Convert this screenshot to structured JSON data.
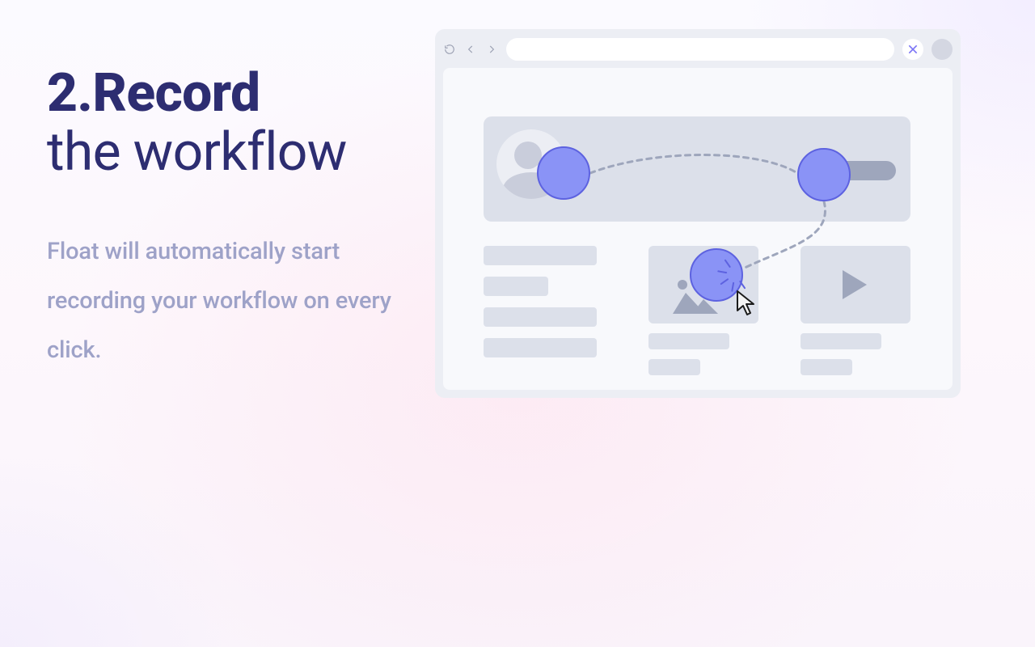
{
  "step": {
    "number": "2.",
    "title": "Record",
    "subtitle": "the workflow",
    "description": "Float will automatically start recording your workflow on every click."
  },
  "icons": {
    "reload": "reload-icon",
    "back": "back-icon",
    "forward": "forward-icon",
    "extension": "float-extension-icon",
    "avatar": "profile-avatar",
    "play": "play-icon",
    "image": "image-icon",
    "cursor": "cursor-icon"
  },
  "colors": {
    "heading": "#2d2d71",
    "body": "#9ea2c8",
    "node_fill": "#8a93f6",
    "node_stroke": "#5d62e0",
    "skeleton": "#dce0ea"
  }
}
